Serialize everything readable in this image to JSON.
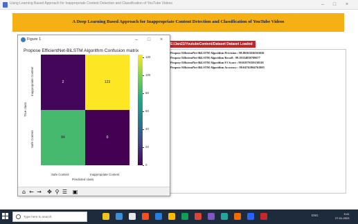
{
  "app_window": {
    "title": "Using Learning Based Approach for Inappropriate Content Detection and Classification of YouTube Videos",
    "minimize": "–",
    "maximize": "□",
    "close": "×"
  },
  "banner": {
    "title": "A Deep Learning Based Approach for Inappropriate Content Detection and Classification of YouTube Videos",
    "color": "#f5b014"
  },
  "path_label": "E:/Jan23/YoutubeContent/Dataset Dataset Loaded",
  "results": [
    "Propose EfficientNet-BiLSTM Algorithm Precision  : 98.86363636363636",
    "Propose EfficientNet-BiLSTM Algorithm Recall     : 99.19354838709677",
    "Propose EfficientNet-BiLSTM Algorithm F1 Score   : 99.01879359158318",
    "Propose EfficientNet-BiLSTM Algorithm Accuracy   : 99.04761904761905"
  ],
  "figure_window": {
    "title": "Figure 1",
    "minimize": "–",
    "maximize": "□",
    "close": "×"
  },
  "chart_data": {
    "type": "heatmap",
    "title": "Propose EfficientNet-BiLSTM Algorithm Confusion matrix",
    "xlabel": "Predicted class",
    "ylabel": "True class",
    "x_categories": [
      "Safe Content",
      "Inappropriate Content"
    ],
    "y_categories": [
      "Inappropriate Content",
      "Safe Content"
    ],
    "matrix": [
      [
        2,
        123
      ],
      [
        84,
        0
      ]
    ],
    "colormap": "viridis",
    "colorbar_ticks": [
      0,
      20,
      40,
      60,
      80,
      100,
      120
    ],
    "colorbar_range": [
      0,
      123
    ]
  },
  "toolbar": {
    "home": "⌂",
    "back": "←",
    "forward": "→",
    "pan": "✥",
    "zoom": "⚲",
    "configure": "☰",
    "save": "▣"
  },
  "taskbar": {
    "search_placeholder": "Type here to search",
    "tray_text": "ENG",
    "time": "9:41",
    "date": "27-01-2023"
  }
}
